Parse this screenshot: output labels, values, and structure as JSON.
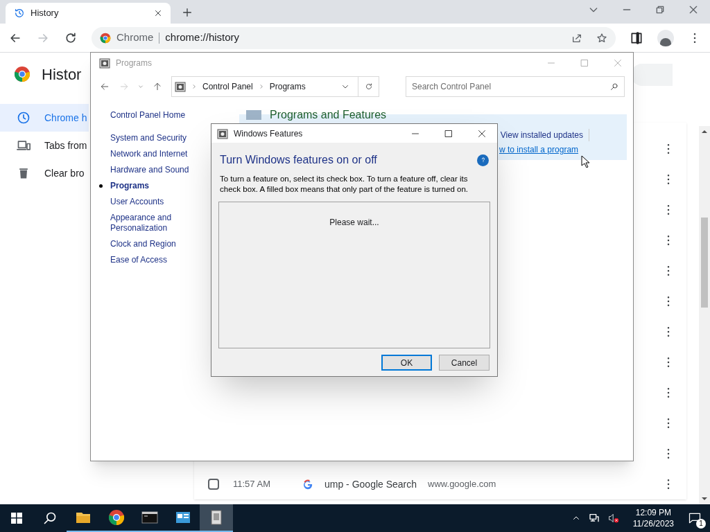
{
  "browser": {
    "tab": {
      "title": "History",
      "selected": true
    },
    "omnibox": {
      "site": "Chrome",
      "url": "chrome://history"
    },
    "page_title": "Histor",
    "sidebar": [
      {
        "label": "Chrome h",
        "selected": true
      },
      {
        "label": "Tabs from",
        "selected": false
      },
      {
        "label": "Clear bro",
        "selected": false
      }
    ],
    "rows": [
      {
        "kind": "covered"
      },
      {
        "kind": "covered"
      },
      {
        "kind": "covered"
      },
      {
        "kind": "covered"
      },
      {
        "kind": "covered"
      },
      {
        "kind": "covered"
      },
      {
        "kind": "covered"
      },
      {
        "kind": "covered"
      },
      {
        "kind": "covered"
      },
      {
        "kind": "covered"
      },
      {
        "kind": "covered"
      },
      {
        "kind": "visit",
        "checked": false,
        "time": "11:57 AM",
        "title": "ump - Google Search",
        "domain": "www.google.com"
      }
    ]
  },
  "control_panel": {
    "title": "Programs",
    "breadcrumb": [
      "Control Panel",
      "Programs"
    ],
    "search": {
      "placeholder": "Search Control Panel"
    },
    "nav": [
      {
        "label": "Control Panel Home",
        "selected": false
      },
      {
        "label": "System and Security",
        "selected": false
      },
      {
        "label": "Network and Internet",
        "selected": false
      },
      {
        "label": "Hardware and Sound",
        "selected": false
      },
      {
        "label": "Programs",
        "selected": true
      },
      {
        "label": "User Accounts",
        "selected": false
      },
      {
        "label": "Appearance and Personalization",
        "selected": false
      },
      {
        "label": "Clock and Region",
        "selected": false
      },
      {
        "label": "Ease of Access",
        "selected": false
      }
    ],
    "section": {
      "heading": "Programs and Features",
      "links": [
        "View installed updates",
        "w to install a program"
      ]
    }
  },
  "dialog": {
    "title": "Windows Features",
    "heading": "Turn Windows features on or off",
    "description": "To turn a feature on, select its check box. To turn a feature off, clear its check box. A filled box means that only part of the feature is turned on.",
    "status": "Please wait...",
    "buttons": [
      "OK",
      "Cancel"
    ]
  },
  "taskbar": {
    "apps": [
      {
        "kind": "explorer",
        "selected": false
      },
      {
        "kind": "chrome",
        "selected": false
      },
      {
        "kind": "terminal",
        "selected": false
      },
      {
        "kind": "control",
        "selected": false
      },
      {
        "kind": "features",
        "selected": true
      }
    ],
    "time": "12:09 PM",
    "date": "11/26/2023",
    "notifications": "1"
  }
}
